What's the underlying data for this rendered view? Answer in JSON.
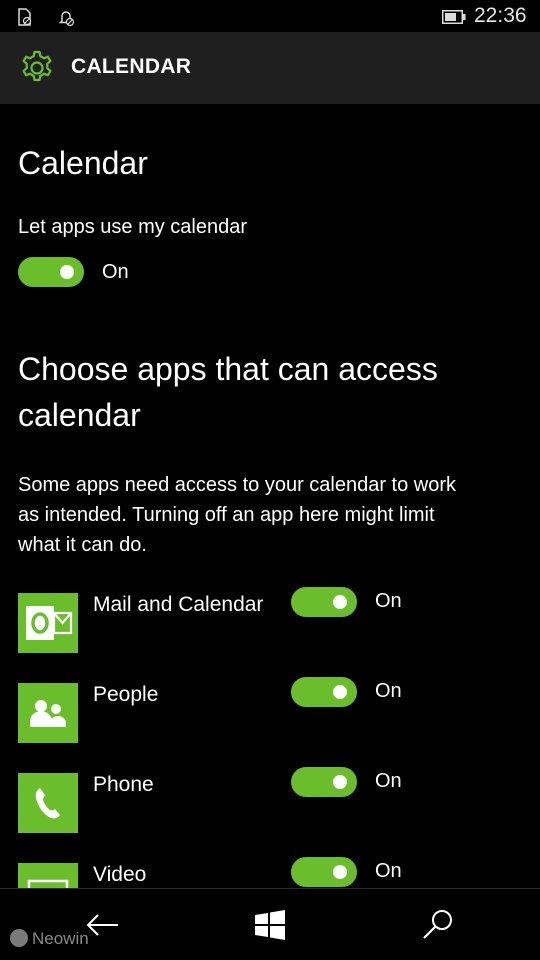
{
  "status_bar": {
    "time": "22:36",
    "icons": [
      "no-sim-icon",
      "alarm-off-icon",
      "battery-icon"
    ]
  },
  "header": {
    "icon": "gear-icon",
    "title": "CALENDAR"
  },
  "section_calendar": {
    "heading": "Calendar",
    "setting_label": "Let apps use my calendar",
    "toggle_state": "On"
  },
  "section_apps": {
    "heading_line1": "Choose apps that can access",
    "heading_line2": "calendar",
    "description_line1": "Some apps need access to your calendar to work",
    "description_line2": "as intended. Turning off an app here might limit",
    "description_line3": "what it can do.",
    "apps": [
      {
        "name": "Mail and Calendar",
        "icon": "outlook-mail-icon",
        "state": "On"
      },
      {
        "name": "People",
        "icon": "people-icon",
        "state": "On"
      },
      {
        "name": "Phone",
        "icon": "phone-icon",
        "state": "On"
      },
      {
        "name": "Video",
        "icon": "video-icon",
        "state": "On"
      }
    ]
  },
  "colors": {
    "accent": "#6bbe2b",
    "background": "#000000",
    "header_bg": "#1f1f1f"
  },
  "nav_bar": {
    "buttons": [
      "back-arrow-icon",
      "windows-start-icon",
      "search-icon"
    ],
    "watermark": "Neowin"
  }
}
